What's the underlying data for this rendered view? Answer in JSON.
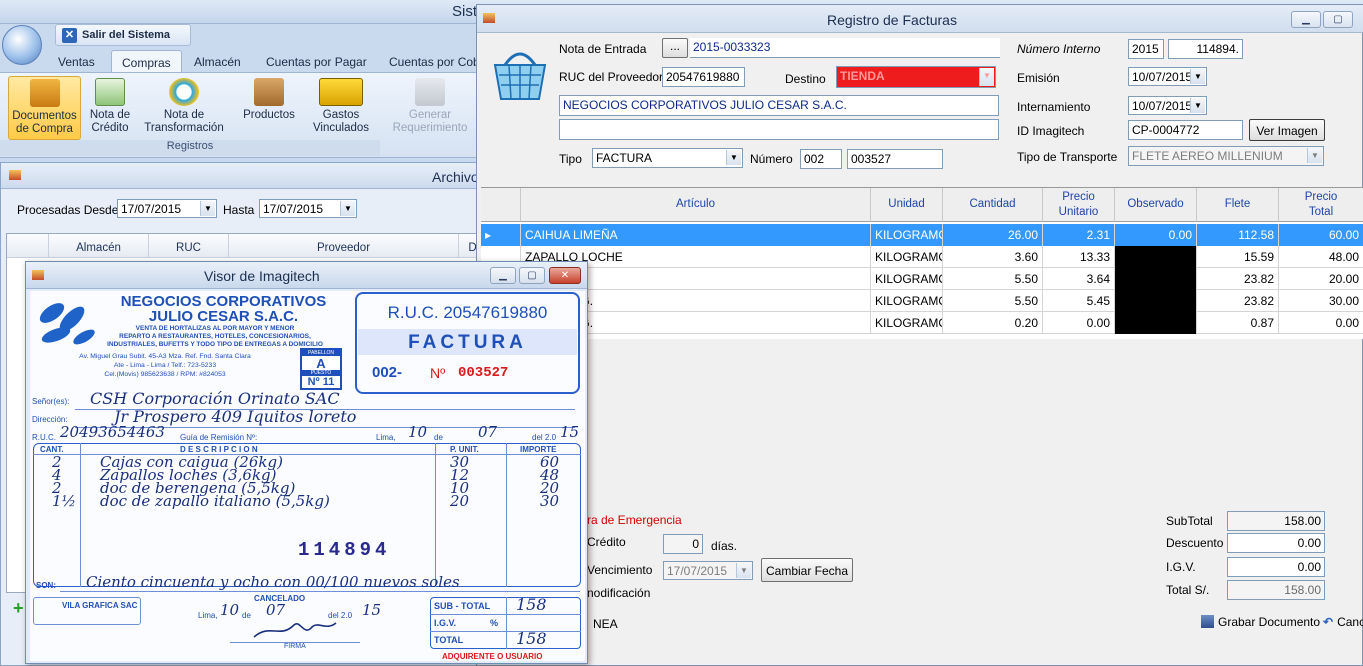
{
  "app": {
    "title": "Sist",
    "exit_label": "Salir del Sistema",
    "tabs": [
      "Ventas",
      "Compras",
      "Almacén",
      "Cuentas por Pagar",
      "Cuentas por Cob"
    ],
    "ribbon_buttons": [
      {
        "label1": "Documentos",
        "label2": "de Compra",
        "icon": "shopping-bag-icon"
      },
      {
        "label1": "Nota de",
        "label2": "Crédito",
        "icon": "credit-note-icon"
      },
      {
        "label1": "Nota de",
        "label2": "Transformación",
        "icon": "transform-icon"
      },
      {
        "label1": "Productos",
        "label2": "",
        "icon": "box-icon"
      },
      {
        "label1": "Gastos",
        "label2": "Vinculados",
        "icon": "truck-icon"
      },
      {
        "label1": "Generar",
        "label2": "Requerimiento",
        "icon": "requirement-icon"
      }
    ],
    "group_label": "Registros"
  },
  "archivo": {
    "title": "Archivo",
    "desde_label": "Procesadas Desde",
    "desde_value": "17/07/2015",
    "hasta_label": "Hasta",
    "hasta_value": "17/07/2015",
    "columns": [
      "Almacén",
      "RUC",
      "Proveedor",
      "D"
    ]
  },
  "registro": {
    "title": "Registro de Facturas",
    "nota_entrada_label": "Nota de Entrada",
    "nota_entrada_btn": "...",
    "nota_entrada_value": "2015-0033323",
    "ruc_label": "RUC del Proveedor",
    "ruc_value": "20547619880",
    "destino_label": "Destino",
    "destino_value": "TIENDA",
    "proveedor_name": "NEGOCIOS CORPORATIVOS JULIO CESAR S.A.C.",
    "tipo_label": "Tipo",
    "tipo_value": "FACTURA",
    "numero_label": "Número",
    "numero_serie": "002",
    "numero_value": "003527",
    "numero_interno_label": "Número Interno",
    "numero_interno_year": "2015",
    "numero_interno_value": "114894.",
    "emision_label": "Emisión",
    "emision_value": "10/07/2015",
    "internamiento_label": "Internamiento",
    "internamiento_value": "10/07/2015",
    "imagitech_label": "ID Imagitech",
    "imagitech_value": "CP-0004772",
    "ver_imagen": "Ver Imagen",
    "transporte_label": "Tipo de Transporte",
    "transporte_value": "FLETE AEREO MILLENIUM",
    "grid_columns": [
      {
        "l1": "Artículo",
        "l2": ""
      },
      {
        "l1": "Unidad",
        "l2": ""
      },
      {
        "l1": "Cantidad",
        "l2": ""
      },
      {
        "l1": "Precio",
        "l2": "Unitario"
      },
      {
        "l1": "Observado",
        "l2": ""
      },
      {
        "l1": "Flete",
        "l2": ""
      },
      {
        "l1": "Precio",
        "l2": "Total"
      }
    ],
    "rows": [
      {
        "articulo": "CAIHUA LIMEÑA",
        "unidad": "KILOGRAMO",
        "cantidad": "26.00",
        "precio": "2.31",
        "observado": "0.00",
        "flete": "112.58",
        "total": "60.00"
      },
      {
        "articulo": "ZAPALLO LOCHE",
        "unidad": "KILOGRAMO",
        "cantidad": "3.60",
        "precio": "13.33",
        "observado": "",
        "flete": "15.59",
        "total": "48.00"
      },
      {
        "articulo": "KG.",
        "unidad": "KILOGRAMO",
        "cantidad": "5.50",
        "precio": "3.64",
        "observado": "",
        "flete": "23.82",
        "total": "20.00"
      },
      {
        "articulo": "ALIANO KG.",
        "unidad": "KILOGRAMO",
        "cantidad": "5.50",
        "precio": "5.45",
        "observado": "",
        "flete": "23.82",
        "total": "30.00"
      },
      {
        "articulo": "ALIANO KG.",
        "unidad": "KILOGRAMO",
        "cantidad": "0.20",
        "precio": "0.00",
        "observado": "",
        "flete": "0.87",
        "total": "0.00"
      }
    ],
    "emergencia": "ra de Emergencia",
    "credito_label": "Crédito",
    "credito_value": "0",
    "dias": "días.",
    "vencimiento_label": "Vencimiento",
    "vencimiento_value": "17/07/2015",
    "cambiar_fecha": "Cambiar Fecha",
    "modificacion": "nodificación",
    "nea": "NEA",
    "subtotal_label": "SubTotal",
    "subtotal_value": "158.00",
    "descuento_label": "Descuento",
    "descuento_value": "0.00",
    "igv_label": "I.G.V.",
    "igv_value": "0.00",
    "total_label": "Total S/.",
    "total_value": "158.00",
    "grabar": "Grabar Documento",
    "cancelar": "Canc"
  },
  "visor": {
    "title": "Visor de Imagitech",
    "company1": "NEGOCIOS CORPORATIVOS",
    "company2": "JULIO CESAR S.A.C.",
    "tagline1": "VENTA DE HORTALIZAS AL POR MAYOR Y MENOR",
    "tagline2": "REPARTO A RESTAURANTES, HOTELES, CONCESIONARIOS,",
    "tagline3": "INDUSTRIALES, BUFETTS Y TODO TIPO DE ENTREGAS A DOMICILIO",
    "address1": "Av. Miguel Grau Subit. 45-A3 Mza. Ref. Fnd. Santa Clara",
    "address2": "Ate - Lima - Lima / Telf.: 723-5233",
    "address3": "Cel.(Movis) 985623638 / RPM: #824053",
    "pabellon": "PABELLON",
    "puesto_letter": "A",
    "puesto": "PUESTO",
    "puesto_no": "Nº 11",
    "ruc": "R.U.C. 20547619880",
    "doc_type": "FACTURA",
    "serie": "002-",
    "no_label": "Nº",
    "numero": "003527",
    "senores_label": "Señor(es):",
    "senores_value": "CSH Corporación Orinato SAC",
    "direccion_label": "Dirección:",
    "direccion_value": "Jr Prospero 409 Iquitos loreto",
    "ruc_label": "R.U.C.",
    "ruc_cliente": "20493654463",
    "guia_label": "Guía de Remisión Nº:",
    "lima_label": "Lima,",
    "dia": "10",
    "de_label": "de",
    "mes": "07",
    "del_label": "del 2.0",
    "anio": "15",
    "col_cant": "CANT.",
    "col_desc": "D E S C R I P C I O N",
    "col_punit": "P. UNIT.",
    "col_importe": "IMPORTE",
    "items": [
      {
        "cant": "2",
        "desc": "Cajas con caigua (26kg)",
        "punit": "30",
        "importe": "60"
      },
      {
        "cant": "4",
        "desc": "Zapallos loches (3,6kg)",
        "punit": "12",
        "importe": "48"
      },
      {
        "cant": "2",
        "desc": "doc de berengena (5,5kg)",
        "punit": "10",
        "importe": "20"
      },
      {
        "cant": "1½",
        "desc": "doc de zapallo italiano (5,5kg)",
        "punit": "20",
        "importe": "30"
      }
    ],
    "stamp_number": "114894",
    "son_label": "SON:",
    "son_value": "Ciento cincuenta y ocho con 00/100 nuevos soles",
    "cancelado": "CANCELADO",
    "cancel_lima": "Lima,",
    "cancel_dia": "10",
    "cancel_de": "de",
    "cancel_mes": "07",
    "cancel_del": "del 2.0",
    "cancel_anio": "15",
    "firma": "FIRMA",
    "printer": "VILA GRAFICA SAC",
    "subtotal_label": "SUB - TOTAL",
    "subtotal_value": "158",
    "igv_label": "I.G.V.",
    "igv_pct": "%",
    "total_label": "TOTAL",
    "total_value": "158",
    "copy_label": "ADQUIRENTE O USUARIO"
  }
}
